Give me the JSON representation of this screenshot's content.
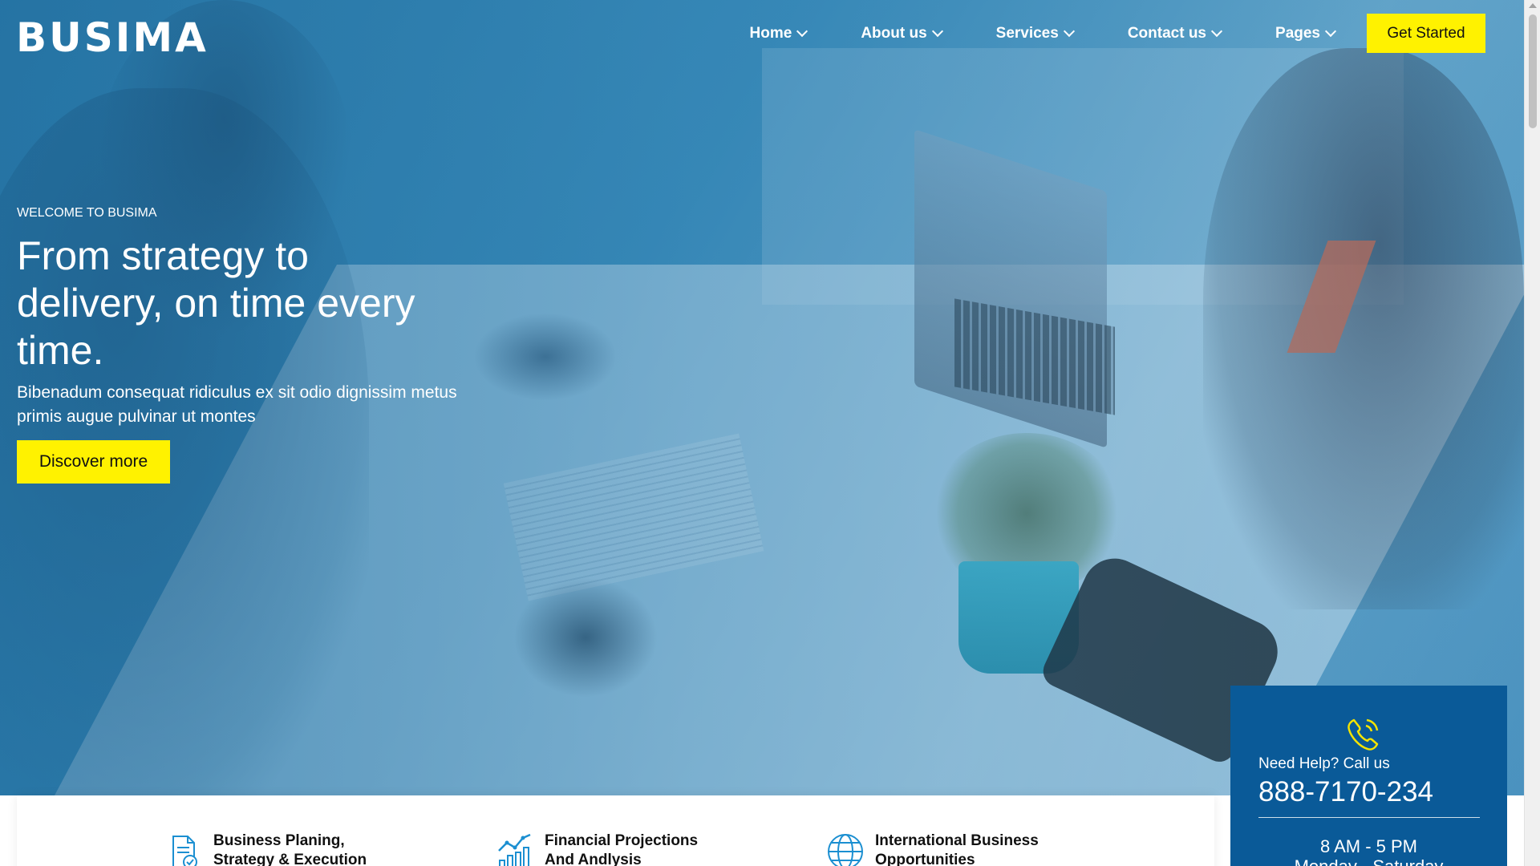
{
  "brand": {
    "logo_text": "BUSIMA"
  },
  "nav": {
    "items": [
      {
        "label": "Home"
      },
      {
        "label": "About us"
      },
      {
        "label": "Services"
      },
      {
        "label": "Contact us"
      },
      {
        "label": "Pages"
      }
    ],
    "cta_label": "Get Started"
  },
  "hero": {
    "eyebrow": "WELCOME TO BUSIMA",
    "headline": "From strategy to delivery, on time every time.",
    "subtext": "Bibenadum consequat ridiculus ex sit odio dignissim metus primis augue pulvinar ut montes",
    "button_label": "Discover more"
  },
  "features": [
    {
      "title": "Business Planing, Strategy & Execution",
      "icon": "document-check-icon"
    },
    {
      "title": "Financial Projections And Andlysis",
      "icon": "chart-growth-icon"
    },
    {
      "title": "International Business Opportunities",
      "icon": "globe-icon"
    }
  ],
  "help": {
    "icon": "phone-icon",
    "label": "Need Help? Call us",
    "number": "888-7170-234",
    "hours": "8 AM - 5 PM",
    "days": "Monday - Saturday"
  },
  "colors": {
    "accent_yellow": "#fff200",
    "help_box_blue": "#0a5a98",
    "feature_icon_blue": "#1b8fd1",
    "help_icon_yellow": "#f5e400"
  }
}
